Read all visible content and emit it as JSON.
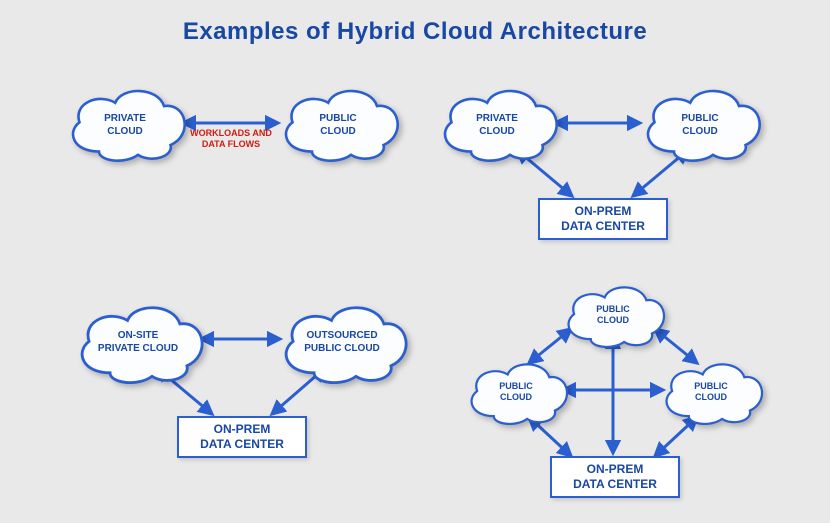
{
  "title": "Examples of Hybrid Cloud Architecture",
  "colors": {
    "primary": "#1848a3",
    "arrow": "#2b5fd0",
    "flow_label": "#d11b0f",
    "bg": "#e9e9e9"
  },
  "q1": {
    "left_cloud": "PRIVATE\nCLOUD",
    "right_cloud": "PUBLIC\nCLOUD",
    "flow_label": "WORKLOADS AND\nDATA FLOWS"
  },
  "q2": {
    "left_cloud": "PRIVATE\nCLOUD",
    "right_cloud": "PUBLIC\nCLOUD",
    "box": "ON-PREM\nDATA CENTER"
  },
  "q3": {
    "left_cloud": "ON-SITE\nPRIVATE CLOUD",
    "right_cloud": "OUTSOURCED\nPUBLIC CLOUD",
    "box": "ON-PREM\nDATA CENTER"
  },
  "q4": {
    "top_cloud": "PUBLIC\nCLOUD",
    "left_cloud": "PUBLIC\nCLOUD",
    "right_cloud": "PUBLIC\nCLOUD",
    "box": "ON-PREM\nDATA CENTER"
  }
}
